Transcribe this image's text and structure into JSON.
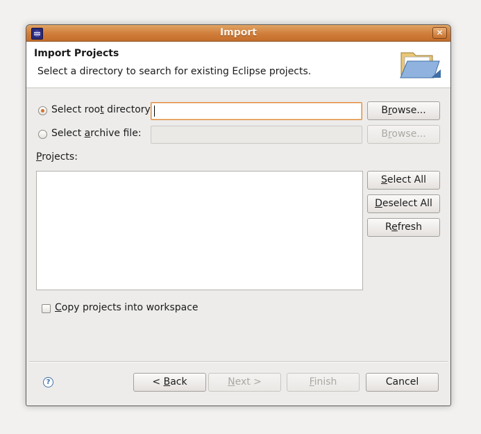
{
  "window": {
    "title": "Import",
    "close_glyph": "✕"
  },
  "header": {
    "title": "Import Projects",
    "description": "Select a directory to search for existing Eclipse projects.",
    "graphic_icon": "open-folder-icon"
  },
  "source": {
    "root_directory": {
      "label_pre": "Select roo",
      "mnemonic": "t",
      "label_post": " directory:",
      "selected": true,
      "value": ""
    },
    "archive_file": {
      "label_pre": "Select ",
      "mnemonic": "a",
      "label_post": "rchive file:",
      "selected": false,
      "value": ""
    },
    "browse_root": {
      "pre": "B",
      "mnemonic": "r",
      "post": "owse..."
    },
    "browse_archive": {
      "pre": "B",
      "mnemonic": "r",
      "post": "owse..."
    }
  },
  "projects": {
    "label_mnemonic": "P",
    "label_rest": "rojects:",
    "items": [],
    "select_all": {
      "mnemonic": "S",
      "rest": "elect All"
    },
    "deselect_all": {
      "mnemonic": "D",
      "rest": "eselect All"
    },
    "refresh": {
      "pre": "R",
      "mnemonic": "e",
      "post": "fresh"
    }
  },
  "options": {
    "copy_mnemonic": "C",
    "copy_rest": "opy projects into workspace",
    "copy_checked": false
  },
  "footer": {
    "help_glyph": "?",
    "back": {
      "pre": "< ",
      "mnemonic": "B",
      "post": "ack"
    },
    "next": {
      "mnemonic": "N",
      "post": "ext >"
    },
    "finish": {
      "mnemonic": "F",
      "post": "inish"
    },
    "cancel_label": "Cancel"
  },
  "colors": {
    "titlebar": "#d07d3a",
    "radio_selected": "#d6722a",
    "focus_border": "#e08a3c"
  }
}
